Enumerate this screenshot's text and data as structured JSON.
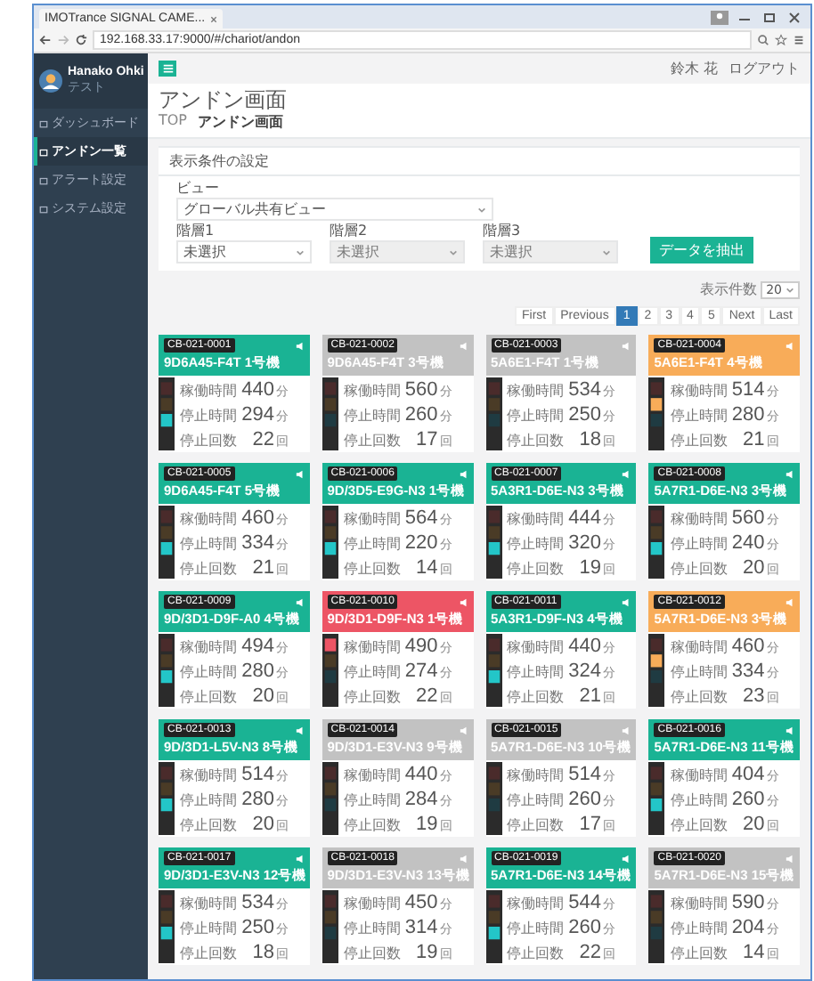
{
  "browser": {
    "tab_title": "IMOTrance SIGNAL CAME...",
    "url": "192.168.33.17:9000/#/chariot/andon"
  },
  "sidebar": {
    "user_name": "Hanako Ohki",
    "user_role": "テスト",
    "items": [
      {
        "label": "ダッシュボード",
        "selected": false
      },
      {
        "label": "アンドン一覧",
        "selected": true
      },
      {
        "label": "アラート設定",
        "selected": false
      },
      {
        "label": "システム設定",
        "selected": false
      }
    ]
  },
  "header": {
    "user": "鈴木 花",
    "logout": "ログアウト"
  },
  "page": {
    "title": "アンドン画面",
    "breadcrumb": [
      "TOP",
      "アンドン画面"
    ]
  },
  "filter": {
    "title": "表示条件の設定",
    "view_label": "ビュー",
    "view_value": "グローバル共有ビュー",
    "levels": [
      {
        "label": "階層1",
        "value": "未選択",
        "disabled": false
      },
      {
        "label": "階層2",
        "value": "未選択",
        "disabled": true
      },
      {
        "label": "階層3",
        "value": "未選択",
        "disabled": true
      }
    ],
    "button": "データを抽出"
  },
  "page_size": {
    "label": "表示件数",
    "value": "20"
  },
  "pagination": [
    {
      "label": "First",
      "selected": false
    },
    {
      "label": "Previous",
      "selected": false
    },
    {
      "label": "1",
      "selected": true
    },
    {
      "label": "2",
      "selected": false
    },
    {
      "label": "3",
      "selected": false
    },
    {
      "label": "4",
      "selected": false
    },
    {
      "label": "5",
      "selected": false
    },
    {
      "label": "Next",
      "selected": false
    },
    {
      "label": "Last",
      "selected": false
    }
  ],
  "cards": [
    {
      "code": "CB-021-0001",
      "title": "9D6A45-F4T 1号機",
      "color": "#1ab394",
      "rows": [
        {
          "label": "稼働時間",
          "value": "440",
          "unit": "分"
        },
        {
          "label": "停止時間",
          "value": "294",
          "unit": "分"
        },
        {
          "label": "停止回数",
          "value": "22",
          "unit": "回"
        }
      ]
    },
    {
      "code": "CB-021-0002",
      "title": "9D6A45-F4T 3号機",
      "color": "#c2c2c2",
      "rows": [
        {
          "label": "稼働時間",
          "value": "560",
          "unit": "分"
        },
        {
          "label": "停止時間",
          "value": "260",
          "unit": "分"
        },
        {
          "label": "停止回数",
          "value": "17",
          "unit": "回"
        }
      ]
    },
    {
      "code": "CB-021-0003",
      "title": "5A6E1-F4T 1号機",
      "color": "#c2c2c2",
      "rows": [
        {
          "label": "稼働時間",
          "value": "534",
          "unit": "分"
        },
        {
          "label": "停止時間",
          "value": "250",
          "unit": "分"
        },
        {
          "label": "停止回数",
          "value": "18",
          "unit": "回"
        }
      ]
    },
    {
      "code": "CB-021-0004",
      "title": "5A6E1-F4T 4号機",
      "color": "#f8ac59",
      "rows": [
        {
          "label": "稼働時間",
          "value": "514",
          "unit": "分"
        },
        {
          "label": "停止時間",
          "value": "280",
          "unit": "分"
        },
        {
          "label": "停止回数",
          "value": "21",
          "unit": "回"
        }
      ]
    },
    {
      "code": "CB-021-0005",
      "title": "9D6A45-F4T 5号機",
      "color": "#1ab394",
      "rows": [
        {
          "label": "稼働時間",
          "value": "460",
          "unit": "分"
        },
        {
          "label": "停止時間",
          "value": "334",
          "unit": "分"
        },
        {
          "label": "停止回数",
          "value": "21",
          "unit": "回"
        }
      ]
    },
    {
      "code": "CB-021-0006",
      "title": "9D/3D5-E9G-N3 1号機",
      "color": "#1ab394",
      "rows": [
        {
          "label": "稼働時間",
          "value": "564",
          "unit": "分"
        },
        {
          "label": "停止時間",
          "value": "220",
          "unit": "分"
        },
        {
          "label": "停止回数",
          "value": "14",
          "unit": "回"
        }
      ]
    },
    {
      "code": "CB-021-0007",
      "title": "5A3R1-D6E-N3 3号機",
      "color": "#1ab394",
      "rows": [
        {
          "label": "稼働時間",
          "value": "444",
          "unit": "分"
        },
        {
          "label": "停止時間",
          "value": "320",
          "unit": "分"
        },
        {
          "label": "停止回数",
          "value": "19",
          "unit": "回"
        }
      ]
    },
    {
      "code": "CB-021-0008",
      "title": "5A7R1-D6E-N3 3号機",
      "color": "#1ab394",
      "rows": [
        {
          "label": "稼働時間",
          "value": "560",
          "unit": "分"
        },
        {
          "label": "停止時間",
          "value": "240",
          "unit": "分"
        },
        {
          "label": "停止回数",
          "value": "20",
          "unit": "回"
        }
      ]
    },
    {
      "code": "CB-021-0009",
      "title": "9D/3D1-D9F-A0 4号機",
      "color": "#1ab394",
      "rows": [
        {
          "label": "稼働時間",
          "value": "494",
          "unit": "分"
        },
        {
          "label": "停止時間",
          "value": "280",
          "unit": "分"
        },
        {
          "label": "停止回数",
          "value": "20",
          "unit": "回"
        }
      ]
    },
    {
      "code": "CB-021-0010",
      "title": "9D/3D1-D9F-N3 1号機",
      "color": "#ed5565",
      "rows": [
        {
          "label": "稼働時間",
          "value": "490",
          "unit": "分"
        },
        {
          "label": "停止時間",
          "value": "274",
          "unit": "分"
        },
        {
          "label": "停止回数",
          "value": "22",
          "unit": "回"
        }
      ]
    },
    {
      "code": "CB-021-0011",
      "title": "5A3R1-D9F-N3 4号機",
      "color": "#1ab394",
      "rows": [
        {
          "label": "稼働時間",
          "value": "440",
          "unit": "分"
        },
        {
          "label": "停止時間",
          "value": "324",
          "unit": "分"
        },
        {
          "label": "停止回数",
          "value": "21",
          "unit": "回"
        }
      ]
    },
    {
      "code": "CB-021-0012",
      "title": "5A7R1-D6E-N3 3号機",
      "color": "#f8ac59",
      "rows": [
        {
          "label": "稼働時間",
          "value": "460",
          "unit": "分"
        },
        {
          "label": "停止時間",
          "value": "334",
          "unit": "分"
        },
        {
          "label": "停止回数",
          "value": "23",
          "unit": "回"
        }
      ]
    },
    {
      "code": "CB-021-0013",
      "title": "9D/3D1-L5V-N3 8号機",
      "color": "#1ab394",
      "rows": [
        {
          "label": "稼働時間",
          "value": "514",
          "unit": "分"
        },
        {
          "label": "停止時間",
          "value": "280",
          "unit": "分"
        },
        {
          "label": "停止回数",
          "value": "20",
          "unit": "回"
        }
      ]
    },
    {
      "code": "CB-021-0014",
      "title": "9D/3D1-E3V-N3 9号機",
      "color": "#c2c2c2",
      "rows": [
        {
          "label": "稼働時間",
          "value": "440",
          "unit": "分"
        },
        {
          "label": "停止時間",
          "value": "284",
          "unit": "分"
        },
        {
          "label": "停止回数",
          "value": "19",
          "unit": "回"
        }
      ]
    },
    {
      "code": "CB-021-0015",
      "title": "5A7R1-D6E-N3 10号機",
      "color": "#c2c2c2",
      "rows": [
        {
          "label": "稼働時間",
          "value": "514",
          "unit": "分"
        },
        {
          "label": "停止時間",
          "value": "260",
          "unit": "分"
        },
        {
          "label": "停止回数",
          "value": "17",
          "unit": "回"
        }
      ]
    },
    {
      "code": "CB-021-0016",
      "title": "5A7R1-D6E-N3 11号機",
      "color": "#1ab394",
      "rows": [
        {
          "label": "稼働時間",
          "value": "404",
          "unit": "分"
        },
        {
          "label": "停止時間",
          "value": "260",
          "unit": "分"
        },
        {
          "label": "停止回数",
          "value": "20",
          "unit": "回"
        }
      ]
    },
    {
      "code": "CB-021-0017",
      "title": "9D/3D1-E3V-N3 12号機",
      "color": "#1ab394",
      "rows": [
        {
          "label": "稼働時間",
          "value": "534",
          "unit": "分"
        },
        {
          "label": "停止時間",
          "value": "250",
          "unit": "分"
        },
        {
          "label": "停止回数",
          "value": "18",
          "unit": "回"
        }
      ]
    },
    {
      "code": "CB-021-0018",
      "title": "9D/3D1-E3V-N3 13号機",
      "color": "#c2c2c2",
      "rows": [
        {
          "label": "稼働時間",
          "value": "450",
          "unit": "分"
        },
        {
          "label": "停止時間",
          "value": "314",
          "unit": "分"
        },
        {
          "label": "停止回数",
          "value": "19",
          "unit": "回"
        }
      ]
    },
    {
      "code": "CB-021-0019",
      "title": "5A7R1-D6E-N3 14号機",
      "color": "#1ab394",
      "rows": [
        {
          "label": "稼働時間",
          "value": "544",
          "unit": "分"
        },
        {
          "label": "停止時間",
          "value": "260",
          "unit": "分"
        },
        {
          "label": "停止回数",
          "value": "22",
          "unit": "回"
        }
      ]
    },
    {
      "code": "CB-021-0020",
      "title": "5A7R1-D6E-N3 15号機",
      "color": "#c2c2c2",
      "rows": [
        {
          "label": "稼働時間",
          "value": "590",
          "unit": "分"
        },
        {
          "label": "停止時間",
          "value": "204",
          "unit": "分"
        },
        {
          "label": "停止回数",
          "value": "14",
          "unit": "回"
        }
      ]
    }
  ]
}
